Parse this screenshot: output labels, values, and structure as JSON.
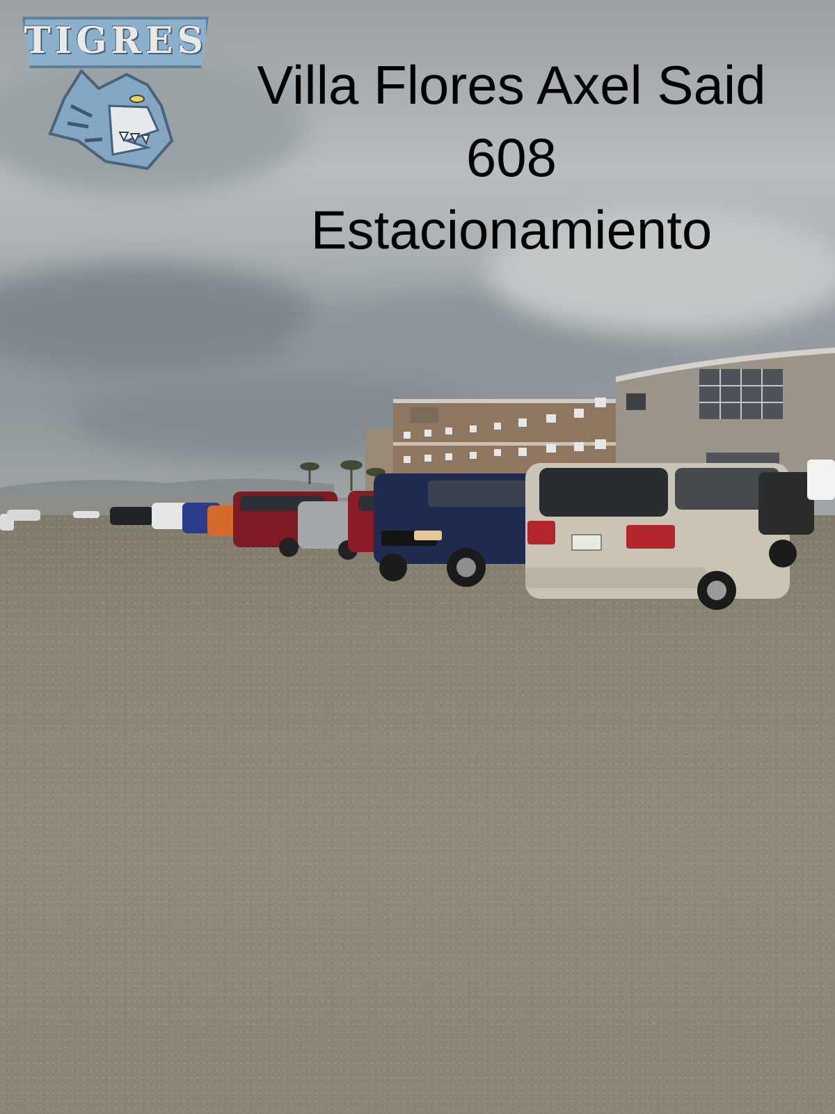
{
  "overlay_text": {
    "line1": "Villa Flores Axel Said",
    "line2": "608",
    "line3": "Estacionamiento"
  },
  "logo": {
    "text": "TIGRES",
    "icon": "tiger-mascot-icon",
    "colors": {
      "primary": "#8ab0cc",
      "outline": "#4a5f72"
    }
  },
  "scene": {
    "colors": {
      "sky": "#aeb4b6",
      "ground": "#8b8573",
      "building": "#8a7560"
    }
  }
}
